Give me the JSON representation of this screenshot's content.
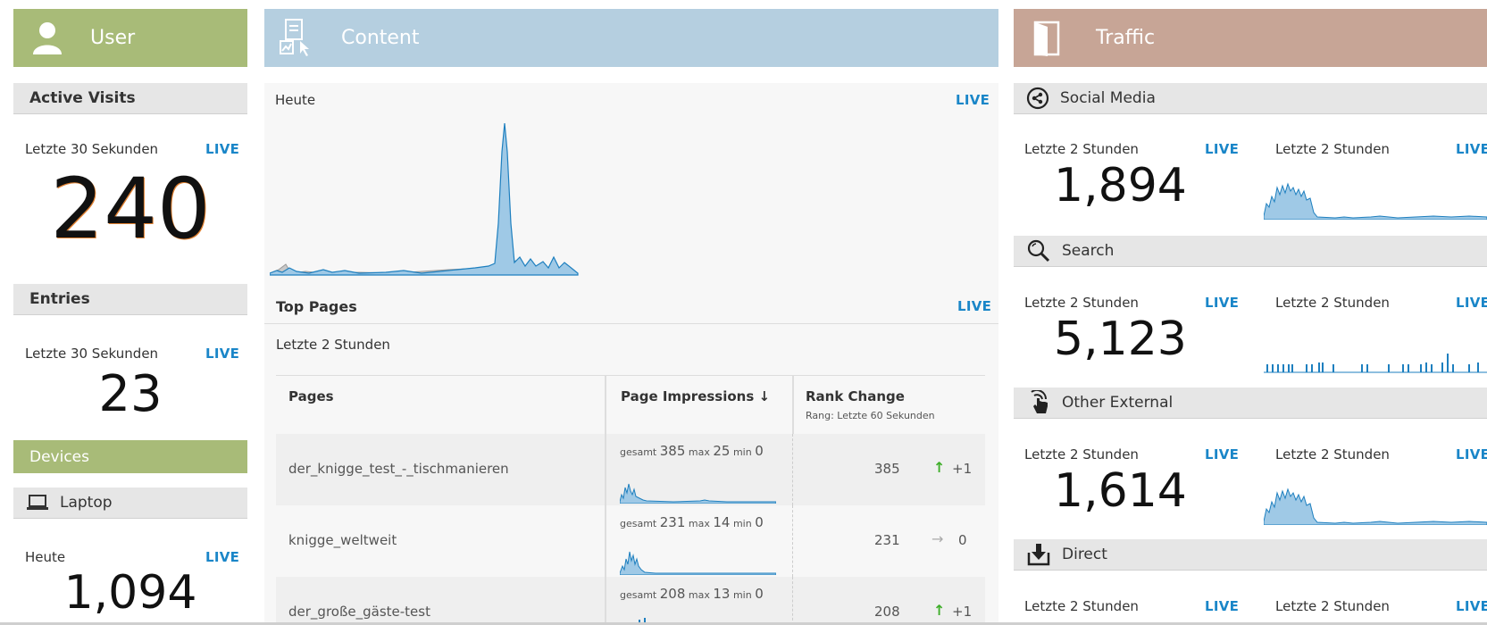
{
  "colors": {
    "user": "#a8bb78",
    "content": "#b5cfe0",
    "traffic": "#c7a596",
    "accent": "#1a86c8",
    "sparkline": "#3393cf",
    "sparkfill": "#9fc9e6"
  },
  "user": {
    "header": "User",
    "active_visits_title": "Active Visits",
    "active_visits_period": "Letzte 30 Sekunden",
    "active_visits_live": "LIVE",
    "active_visits_value": "240",
    "entries_title": "Entries",
    "entries_period": "Letzte 30 Sekunden",
    "entries_live": "LIVE",
    "entries_value": "23",
    "devices_title": "Devices",
    "laptop_label": "Laptop",
    "laptop_period": "Heute",
    "laptop_live": "LIVE",
    "laptop_value": "1,094"
  },
  "content": {
    "header": "Content",
    "today_label": "Heute",
    "today_live": "LIVE",
    "top_pages_title": "Top Pages",
    "top_pages_live": "LIVE",
    "top_pages_period": "Letzte 2 Stunden",
    "col_pages": "Pages",
    "col_impressions": "Page Impressions ↓",
    "col_rank": "Rank Change",
    "col_rank_sub": "Rang: Letzte 60 Sekunden",
    "rows": [
      {
        "page": "der_knigge_test_-_tischmanieren",
        "gesamt_label": "gesamt",
        "gesamt": "385",
        "max_label": "max",
        "max": "25",
        "min_label": "min",
        "min": "0",
        "rank_value": "385",
        "rank_dir": "up",
        "rank_change": "+1"
      },
      {
        "page": "knigge_weltweit",
        "gesamt_label": "gesamt",
        "gesamt": "231",
        "max_label": "max",
        "max": "14",
        "min_label": "min",
        "min": "0",
        "rank_value": "231",
        "rank_dir": "same",
        "rank_change": "0"
      },
      {
        "page": "der_große_gäste-test",
        "gesamt_label": "gesamt",
        "gesamt": "208",
        "max_label": "max",
        "max": "13",
        "min_label": "min",
        "min": "0",
        "rank_value": "208",
        "rank_dir": "up",
        "rank_change": "+1"
      }
    ]
  },
  "traffic": {
    "header": "Traffic",
    "sections": [
      {
        "name": "Social Media",
        "icon": "share-icon",
        "period1": "Letzte 2 Stunden",
        "live1": "LIVE",
        "value": "1,894",
        "period2": "Letzte 2 Stunden",
        "live2": "LIVE"
      },
      {
        "name": "Search",
        "icon": "search-icon",
        "period1": "Letzte 2 Stunden",
        "live1": "LIVE",
        "value": "5,123",
        "period2": "Letzte 2 Stunden",
        "live2": "LIVE"
      },
      {
        "name": "Other External",
        "icon": "pointer-hand-icon",
        "period1": "Letzte 2 Stunden",
        "live1": "LIVE",
        "value": "1,614",
        "period2": "Letzte 2 Stunden",
        "live2": "LIVE"
      },
      {
        "name": "Direct",
        "icon": "download-icon",
        "period1": "Letzte 2 Stunden",
        "live1": "LIVE",
        "period2": "Letzte 2 Stunden",
        "live2": "LIVE"
      }
    ]
  }
}
